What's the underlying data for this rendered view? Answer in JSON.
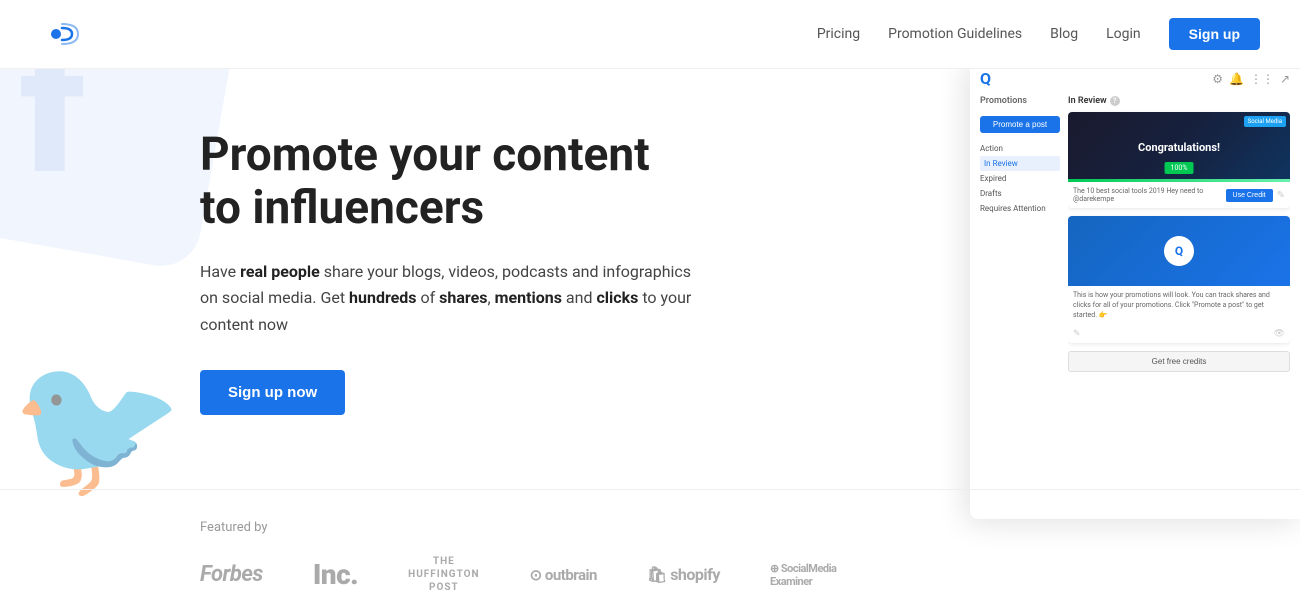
{
  "header": {
    "logo_symbol": "📡",
    "nav": {
      "pricing": "Pricing",
      "guidelines": "Promotion Guidelines",
      "blog": "Blog",
      "login": "Login",
      "signup": "Sign up"
    }
  },
  "hero": {
    "title_line1": "Promote your content",
    "title_line2": "to influencers",
    "subtitle_part1": "Have ",
    "subtitle_bold1": "real people",
    "subtitle_part2": " share your blogs, videos, podcasts and infographics on social media. Get ",
    "subtitle_bold2": "hundreds",
    "subtitle_part3": " of ",
    "subtitle_bold3": "shares",
    "subtitle_part4": ", ",
    "subtitle_bold4": "mentions",
    "subtitle_part5": " and ",
    "subtitle_bold5": "clicks",
    "subtitle_part6": " to your content now",
    "cta_button": "Sign up now"
  },
  "app_preview": {
    "logo": "Q",
    "sidebar": {
      "title": "Promotions",
      "promote_btn": "Promote a post",
      "nav_items": [
        "Action",
        "In Review",
        "Expired",
        "Drafts",
        "Requires Attention"
      ]
    },
    "main": {
      "section_title": "In Review",
      "card1": {
        "img_text": "Congratulations!",
        "success_label": "100%",
        "article_title": "The 10 best social tools 2019 Hey need to @darekempe",
        "use_credit_btn": "Use Credit",
        "social_badge": "Social Media"
      },
      "card2": {
        "logo": "Q",
        "description": "This is how your promotions will look. You can track shares and clicks for all of your promotions. Click \"Promote a post\" to get started. 👉"
      },
      "get_credits": "Get free credits"
    }
  },
  "featured": {
    "label": "Featured by",
    "logos": [
      {
        "name": "Forbes",
        "css_class": "forbes"
      },
      {
        "name": "Inc.",
        "css_class": "inc"
      },
      {
        "name": "THE\nHUFFINGTON\nPOST",
        "css_class": "huffpost"
      },
      {
        "name": "⊙ Outbrain",
        "css_class": "outbrain"
      },
      {
        "name": "🛍 Shopify",
        "css_class": "shopify"
      },
      {
        "name": "⊕ SocialMedia Examiner",
        "css_class": "socialmedia"
      }
    ]
  },
  "colors": {
    "primary": "#1a73e8",
    "text_dark": "#222",
    "text_muted": "#999",
    "bg_light": "#f0f4ff"
  }
}
